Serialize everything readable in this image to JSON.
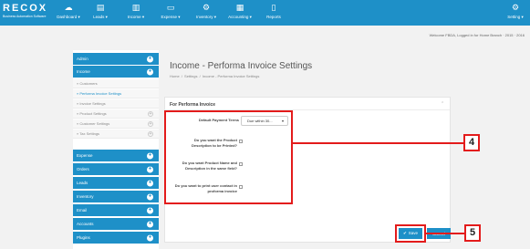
{
  "brand": {
    "name": "RECOX",
    "tagline": "Business Automation Software"
  },
  "topnav": [
    {
      "label": "Dashboard ▾",
      "icon": "dashboard-icon",
      "glyph": "☁"
    },
    {
      "label": "Leads ▾",
      "icon": "leads-icon",
      "glyph": "▤"
    },
    {
      "label": "Income ▾",
      "icon": "income-icon",
      "glyph": "▥"
    },
    {
      "label": "Expense ▾",
      "icon": "expense-icon",
      "glyph": "▭"
    },
    {
      "label": "Inventory ▾",
      "icon": "inventory-icon",
      "glyph": "⚙"
    },
    {
      "label": "Accounting ▾",
      "icon": "accounting-icon",
      "glyph": "▦"
    },
    {
      "label": "Reports",
      "icon": "reports-icon",
      "glyph": "▯"
    }
  ],
  "settings": {
    "label": "Setting ▾",
    "glyph": "⚙"
  },
  "welcome": "Welcome FBDA, Logged in for Home Branch · 2015 · 2016",
  "sidebar": {
    "top": [
      {
        "label": "Admin"
      },
      {
        "label": "Income"
      }
    ],
    "sub": [
      {
        "label": "» Customers",
        "active": false,
        "plus": ""
      },
      {
        "label": "» Performa Invoice Settings",
        "active": true,
        "plus": ""
      },
      {
        "label": "» Invoice Settings",
        "active": false,
        "plus": ""
      },
      {
        "label": "» Product Settings",
        "active": false,
        "plus": "+"
      },
      {
        "label": "» Customer Settings",
        "active": false,
        "plus": "+"
      },
      {
        "label": "» Tax Settings",
        "active": false,
        "plus": "+"
      }
    ],
    "bottom": [
      {
        "label": "Expense"
      },
      {
        "label": "Orders"
      },
      {
        "label": "Leads"
      },
      {
        "label": "Inventory"
      },
      {
        "label": "Email"
      },
      {
        "label": "Accounts"
      },
      {
        "label": "Plugins"
      }
    ]
  },
  "page": {
    "title": "Income - Performa Invoice Settings",
    "breadcrumb": [
      "Home",
      "/",
      "Settings",
      "/",
      "Income - Performa Invoice Settings"
    ]
  },
  "panel": {
    "heading": "For Performa Invoice",
    "collapse": "⌃",
    "payment_terms_label": "Default Payment Terms",
    "payment_terms_value": "Due within 30...",
    "q_product_desc": "Do you want the Product Description to be Printed?",
    "q_name_same_field": "Do you want Product Name and Description in the same field?",
    "q_print_contact": "Do you want to print user contact in proforma invoice"
  },
  "buttons": {
    "save": "Save",
    "cancel": "Cancel"
  },
  "annotations": {
    "callout_4": "4",
    "callout_5": "5"
  },
  "colors": {
    "primary": "#1e90c8",
    "annotation": "#e31b1b"
  }
}
